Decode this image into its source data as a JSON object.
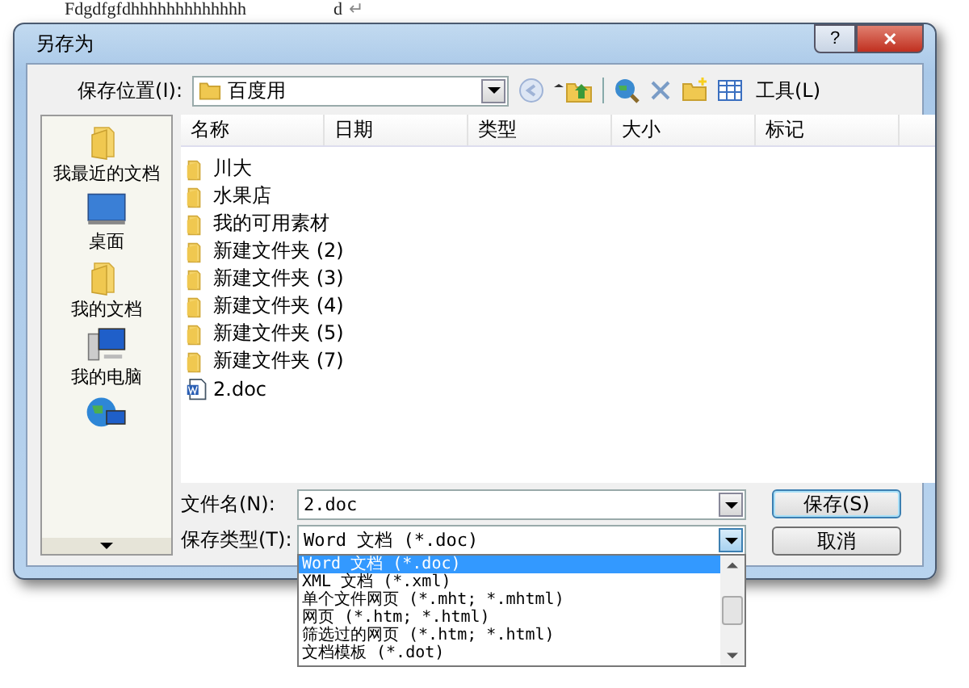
{
  "background_document": {
    "text": "Fdgdfgfdhhhhhhhhhhhhh",
    "tail": "d",
    "return_mark": "↵"
  },
  "window": {
    "title": "另存为",
    "help_button": "?",
    "close_button": "✕"
  },
  "location": {
    "label": "保存位置(I):",
    "value": "百度用"
  },
  "toolbar": {
    "tools_menu": "工具(L)"
  },
  "places": [
    {
      "kind": "recent",
      "label": "我最近的文档"
    },
    {
      "kind": "desktop",
      "label": "桌面"
    },
    {
      "kind": "documents",
      "label": "我的文档"
    },
    {
      "kind": "computer",
      "label": "我的电脑"
    },
    {
      "kind": "network"
    }
  ],
  "columns": [
    "名称",
    "日期",
    "类型",
    "大小",
    "标记"
  ],
  "files": [
    {
      "kind": "folder",
      "name": "川大"
    },
    {
      "kind": "folder",
      "name": "水果店"
    },
    {
      "kind": "folder",
      "name": "我的可用素材"
    },
    {
      "kind": "folder",
      "name": "新建文件夹 (2)"
    },
    {
      "kind": "folder",
      "name": "新建文件夹 (3)"
    },
    {
      "kind": "folder",
      "name": "新建文件夹 (4)"
    },
    {
      "kind": "folder",
      "name": "新建文件夹 (5)"
    },
    {
      "kind": "folder",
      "name": "新建文件夹 (7)"
    },
    {
      "kind": "doc",
      "name": "2.doc"
    }
  ],
  "file_name": {
    "label": "文件名(N):",
    "value": "2.doc"
  },
  "file_type": {
    "label": "保存类型(T):",
    "value": "Word 文档 (*.doc)",
    "expanded": true,
    "options": [
      {
        "label": "Word 文档 (*.doc)",
        "selected": true
      },
      {
        "label": "XML 文档 (*.xml)",
        "selected": false
      },
      {
        "label": "单个文件网页 (*.mht; *.mhtml)",
        "selected": false
      },
      {
        "label": "网页 (*.htm; *.html)",
        "selected": false
      },
      {
        "label": "筛选过的网页 (*.htm; *.html)",
        "selected": false
      },
      {
        "label": "文档模板 (*.dot)",
        "selected": false
      }
    ]
  },
  "buttons": [
    {
      "label": "保存(S)",
      "default": true
    },
    {
      "label": "取消",
      "default": false
    }
  ]
}
